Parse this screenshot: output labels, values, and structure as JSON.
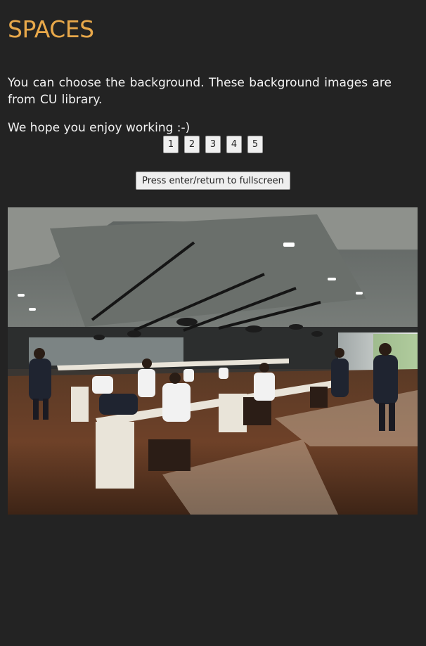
{
  "page": {
    "title": "SPACES",
    "intro": "You can choose the background. These background images are from CU library.",
    "hope": "We hope you enjoy working :-)"
  },
  "pager": {
    "pages": [
      "1",
      "2",
      "3",
      "4",
      "5"
    ]
  },
  "fullscreen": {
    "label": "Press enter/return to fullscreen"
  },
  "colors": {
    "background": "#232323",
    "title": "#e8a84a",
    "text": "#f2f2f2",
    "button_bg": "#efefef"
  }
}
